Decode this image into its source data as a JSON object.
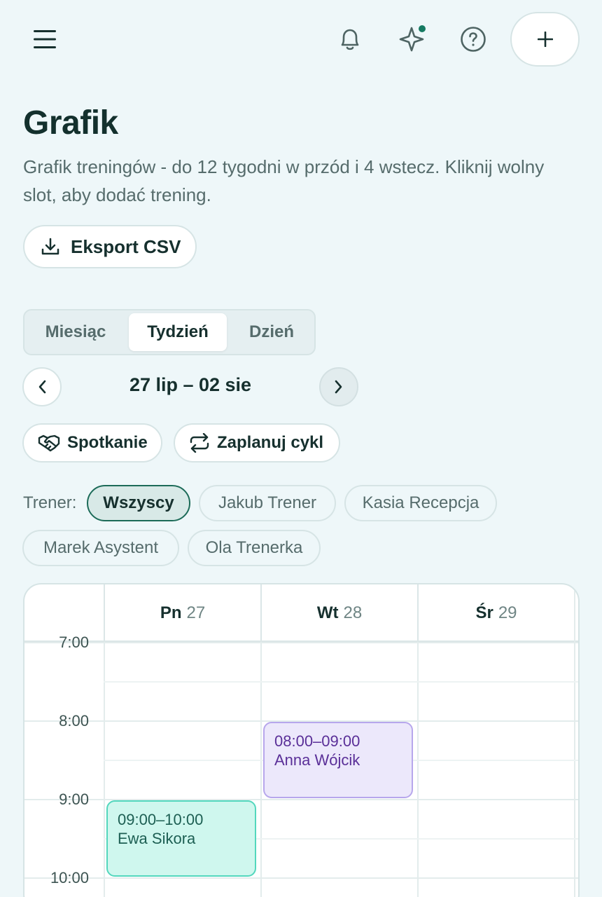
{
  "header": {
    "menu_icon": "hamburger-menu-icon",
    "bell_icon": "bell-icon",
    "sparkle_icon": "sparkle-icon",
    "help_icon": "help-circle-icon",
    "add_icon": "plus-icon",
    "notification_dot_color": "#157a62"
  },
  "page": {
    "title": "Grafik",
    "description": "Grafik treningów - do 12 tygodni w przód i 4 wstecz. Kliknij wolny slot, aby dodać trening.",
    "export_label": "Eksport CSV",
    "export_icon": "download-icon"
  },
  "views": {
    "tabs": [
      "Miesiąc",
      "Tydzień",
      "Dzień"
    ],
    "active": "Tydzień"
  },
  "navigation": {
    "range": "27 lip – 02 sie",
    "prev_icon": "chevron-left-icon",
    "next_icon": "chevron-right-icon"
  },
  "actions": {
    "meeting_label": "Spotkanie",
    "meeting_icon": "handshake-icon",
    "cycle_label": "Zaplanuj cykl",
    "cycle_icon": "repeat-icon"
  },
  "trainer_filter": {
    "label": "Trener:",
    "chips": [
      "Wszyscy",
      "Jakub Trener",
      "Kasia Recepcja",
      "Marek Asystent",
      "Ola Trenerka"
    ],
    "active": "Wszyscy"
  },
  "calendar": {
    "days": [
      {
        "name": "Pn",
        "num": "27"
      },
      {
        "name": "Wt",
        "num": "28"
      },
      {
        "name": "Śr",
        "num": "29"
      }
    ],
    "hours": [
      "7:00",
      "8:00",
      "9:00",
      "10:00"
    ],
    "events": [
      {
        "time": "08:00–09:00",
        "name": "Anna Wójcik",
        "color": "#ece8fb"
      },
      {
        "time": "09:00–10:00",
        "name": "Ewa Sikora",
        "color": "#cff7ee"
      }
    ]
  }
}
